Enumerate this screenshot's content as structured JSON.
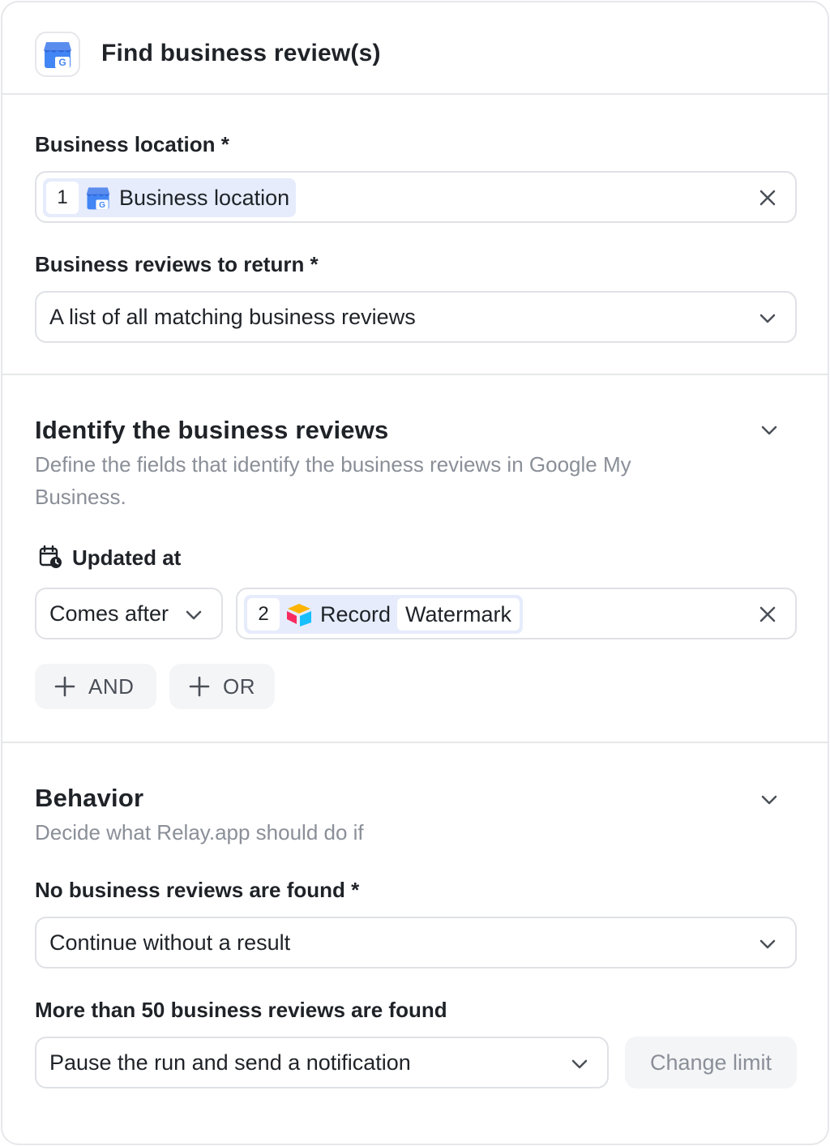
{
  "header": {
    "title": "Find business review(s)",
    "icon": "google-my-business-icon"
  },
  "location": {
    "label": "Business location *",
    "chip_number": "1",
    "chip_icon": "google-my-business-icon",
    "chip_label": "Business location"
  },
  "reviews_return": {
    "label": "Business reviews to return *",
    "value": "A list of all matching business reviews"
  },
  "identify": {
    "title": "Identify the business reviews",
    "description": "Define the fields that identify the business reviews in Google My Business.",
    "field_label": "Updated at",
    "operator": "Comes after",
    "chip_number": "2",
    "chip_icon": "airtable-icon",
    "chip_label_1": "Record",
    "chip_label_2": "Watermark",
    "and_button": "AND",
    "or_button": "OR"
  },
  "behavior": {
    "title": "Behavior",
    "description": "Decide what Relay.app should do if",
    "none_found_label": "No business reviews are found *",
    "none_found_value": "Continue without a result",
    "many_found_label": "More than 50 business reviews are found",
    "many_found_value": "Pause the run and send a notification",
    "change_limit": "Change limit"
  },
  "colors": {
    "border": "#e6e7ea",
    "chip_bg": "#e6ecfb",
    "muted_text": "#8a8f98",
    "ghost_button_bg": "#f4f5f7"
  }
}
